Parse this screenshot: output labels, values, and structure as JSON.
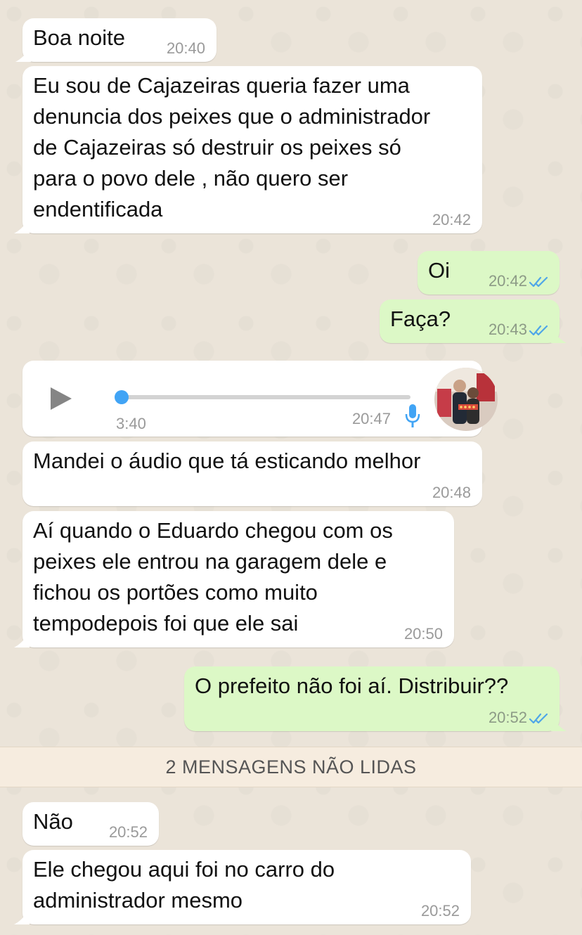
{
  "chat": {
    "messages": [
      {
        "id": "m1",
        "text": "Boa noite",
        "time": "20:40"
      },
      {
        "id": "m2",
        "text": "Eu sou de Cajazeiras queria fazer uma\ndenuncia dos peixes que o administrador\nde Cajazeiras só destruir os peixes só\npara o povo dele , não quero ser\nendentificada",
        "time": "20:42"
      },
      {
        "id": "m3",
        "text": "Oi",
        "time": "20:42"
      },
      {
        "id": "m4",
        "text": "Faça?",
        "time": "20:43"
      },
      {
        "id": "m6",
        "text": "Mandei o áudio que tá esticando melhor",
        "time": "20:48"
      },
      {
        "id": "m7",
        "text": "Aí quando o Eduardo chegou com os\npeixes ele entrou na garagem dele e\nfichou os portões como muito\ntempodepois foi que ele sai",
        "time": "20:50"
      },
      {
        "id": "m8",
        "text": "O prefeito não foi aí. Distribuir??",
        "time": "20:52"
      },
      {
        "id": "m9",
        "text": "Não",
        "time": "20:52"
      },
      {
        "id": "m10",
        "text": "Ele chegou aqui foi no carro do\nadministrador mesmo",
        "time": "20:52"
      }
    ],
    "audio": {
      "duration": "3:40",
      "time": "20:47",
      "progress": 0.0,
      "play_icon": "play-icon",
      "mic_icon": "microphone-icon"
    },
    "unread_banner": "2 MENSAGENS NÃO LIDAS"
  },
  "colors": {
    "incoming_bubble": "#ffffff",
    "outgoing_bubble": "#dcf8c6",
    "read_ticks": "#4fa6e8",
    "wallpaper": "#ebe4d9"
  }
}
